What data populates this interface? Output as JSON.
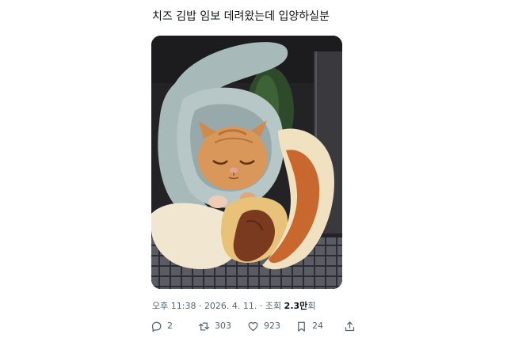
{
  "tweet": {
    "text": "치즈 김밥 임보 데려왔는데 입양하실분",
    "image_alt": "cat-photo"
  },
  "meta": {
    "time": "오후 11:38",
    "sep1": " · ",
    "date": "2026. 4. 11.",
    "sep2": " · ",
    "views_prefix": "조회 ",
    "views_count": "2.3만",
    "views_suffix": "회"
  },
  "actions": {
    "reply_count": "2",
    "retweet_count": "303",
    "like_count": "923",
    "bookmark_count": "24",
    "reply_icon": "reply-icon",
    "retweet_icon": "retweet-icon",
    "like_icon": "heart-icon",
    "bookmark_icon": "bookmark-icon",
    "share_icon": "share-icon"
  },
  "colors": {
    "text": "#0f1419",
    "muted": "#536471"
  }
}
